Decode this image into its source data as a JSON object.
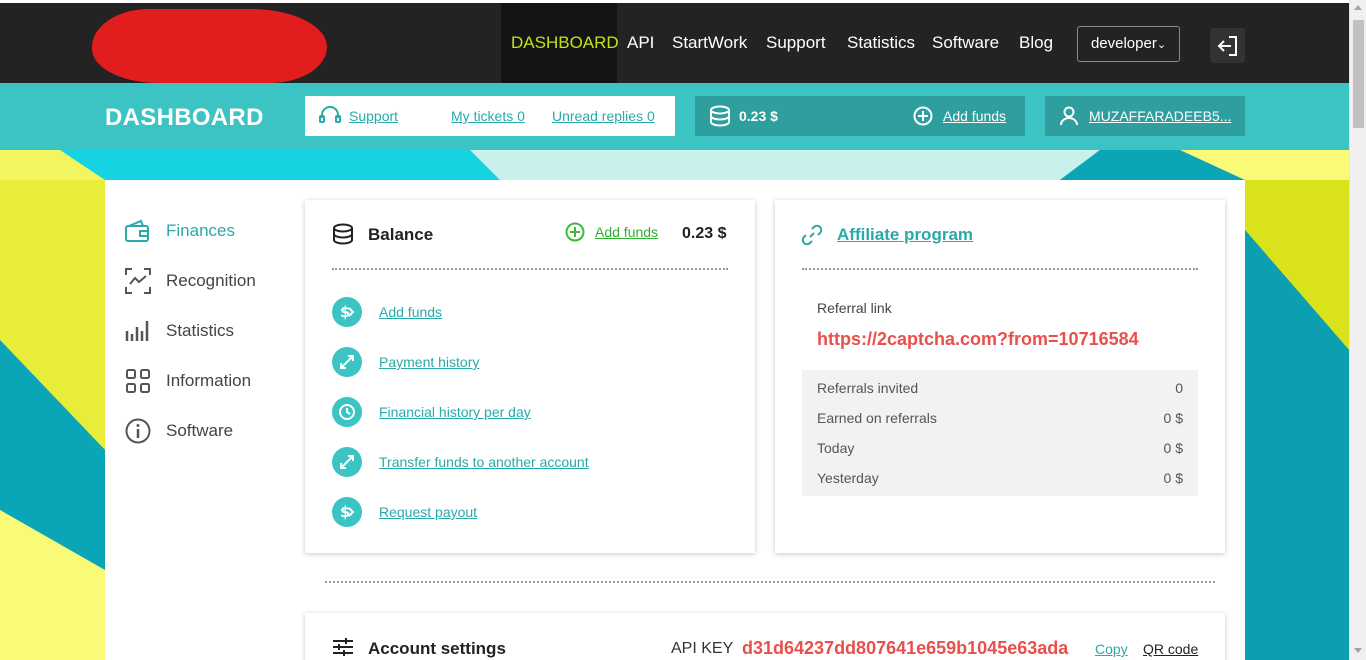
{
  "nav": {
    "items": [
      {
        "label": "DASHBOARD",
        "active": true
      },
      {
        "label": "API"
      },
      {
        "label": "StartWork"
      },
      {
        "label": "Support"
      },
      {
        "label": "Statistics"
      },
      {
        "label": "Software"
      },
      {
        "label": "Blog"
      }
    ],
    "role_select": "developer"
  },
  "subbar": {
    "title": "DASHBOARD",
    "support_label": "Support",
    "my_tickets": "My tickets 0",
    "unread_replies": "Unread replies 0",
    "balance": "0.23 $",
    "add_funds": "Add funds",
    "username": "MUZAFFARADEEB5..."
  },
  "sidebar": {
    "items": [
      {
        "label": "Finances",
        "icon": "wallet-icon",
        "active": true
      },
      {
        "label": "Recognition",
        "icon": "recognition-icon"
      },
      {
        "label": "Statistics",
        "icon": "bar-chart-icon"
      },
      {
        "label": "Information",
        "icon": "grid-icon"
      },
      {
        "label": "Software",
        "icon": "info-icon"
      }
    ]
  },
  "balance_panel": {
    "title": "Balance",
    "add_funds": "Add funds",
    "amount": "0.23 $",
    "links": [
      {
        "label": "Add funds",
        "icon": "dollar-icon"
      },
      {
        "label": "Payment history",
        "icon": "transfer-icon"
      },
      {
        "label": "Financial history per day",
        "icon": "history-icon"
      },
      {
        "label": "Transfer funds to another account",
        "icon": "transfer-icon"
      },
      {
        "label": "Request payout",
        "icon": "dollar-icon"
      }
    ]
  },
  "affiliate_panel": {
    "title": "Affiliate program",
    "referral_label": "Referral link",
    "referral_link": "https://2captcha.com?from=10716584",
    "stats": [
      {
        "label": "Referrals invited",
        "value": "0"
      },
      {
        "label": "Earned on referrals",
        "value": "0 $"
      },
      {
        "label": "Today",
        "value": "0 $"
      },
      {
        "label": "Yesterday",
        "value": "0 $"
      }
    ]
  },
  "account_settings": {
    "title": "Account settings",
    "api_key_label": "API KEY",
    "api_key": "d31d64237dd807641e659b1045e63ada",
    "copy": "Copy",
    "qr_code": "QR code"
  },
  "colors": {
    "teal": "#3cc3c3",
    "dark_teal": "#2e9e9e",
    "lime": "#c3e21a",
    "api_key_red": "#e8504b",
    "nav_bg": "#232323"
  }
}
